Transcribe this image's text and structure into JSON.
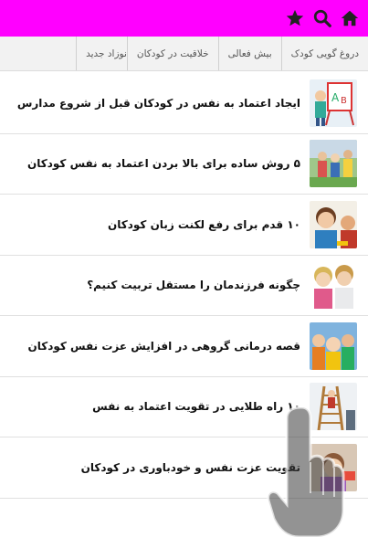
{
  "topbar": {
    "background": "#ff00ff",
    "icons": [
      "home-icon",
      "search-icon",
      "star-icon"
    ]
  },
  "tabs": [
    {
      "label": "دروغ گویی کودک"
    },
    {
      "label": "بیش فعالی"
    },
    {
      "label": "خلاقیت در کودکان"
    },
    {
      "label": "نوزاد جدید"
    }
  ],
  "articles": [
    {
      "title": "ایجاد اعتماد به نفس در کودکان قبل از شروع مدارس"
    },
    {
      "title": "۵ روش ساده برای بالا بردن اعتماد به نفس کودکان"
    },
    {
      "title": "۱۰ قدم برای رفع لکنت زبان کودکان"
    },
    {
      "title": "چگونه فرزندمان را مستقل تربیت کنیم؟"
    },
    {
      "title": "قصه درمانی گروهی در افزایش عزت نفس کودکان"
    },
    {
      "title": "۱۰ راه طلایی در تقویت اعتماد به نفس"
    },
    {
      "title": "تقویت عزت نفس و خودباوری در کودکان"
    }
  ]
}
